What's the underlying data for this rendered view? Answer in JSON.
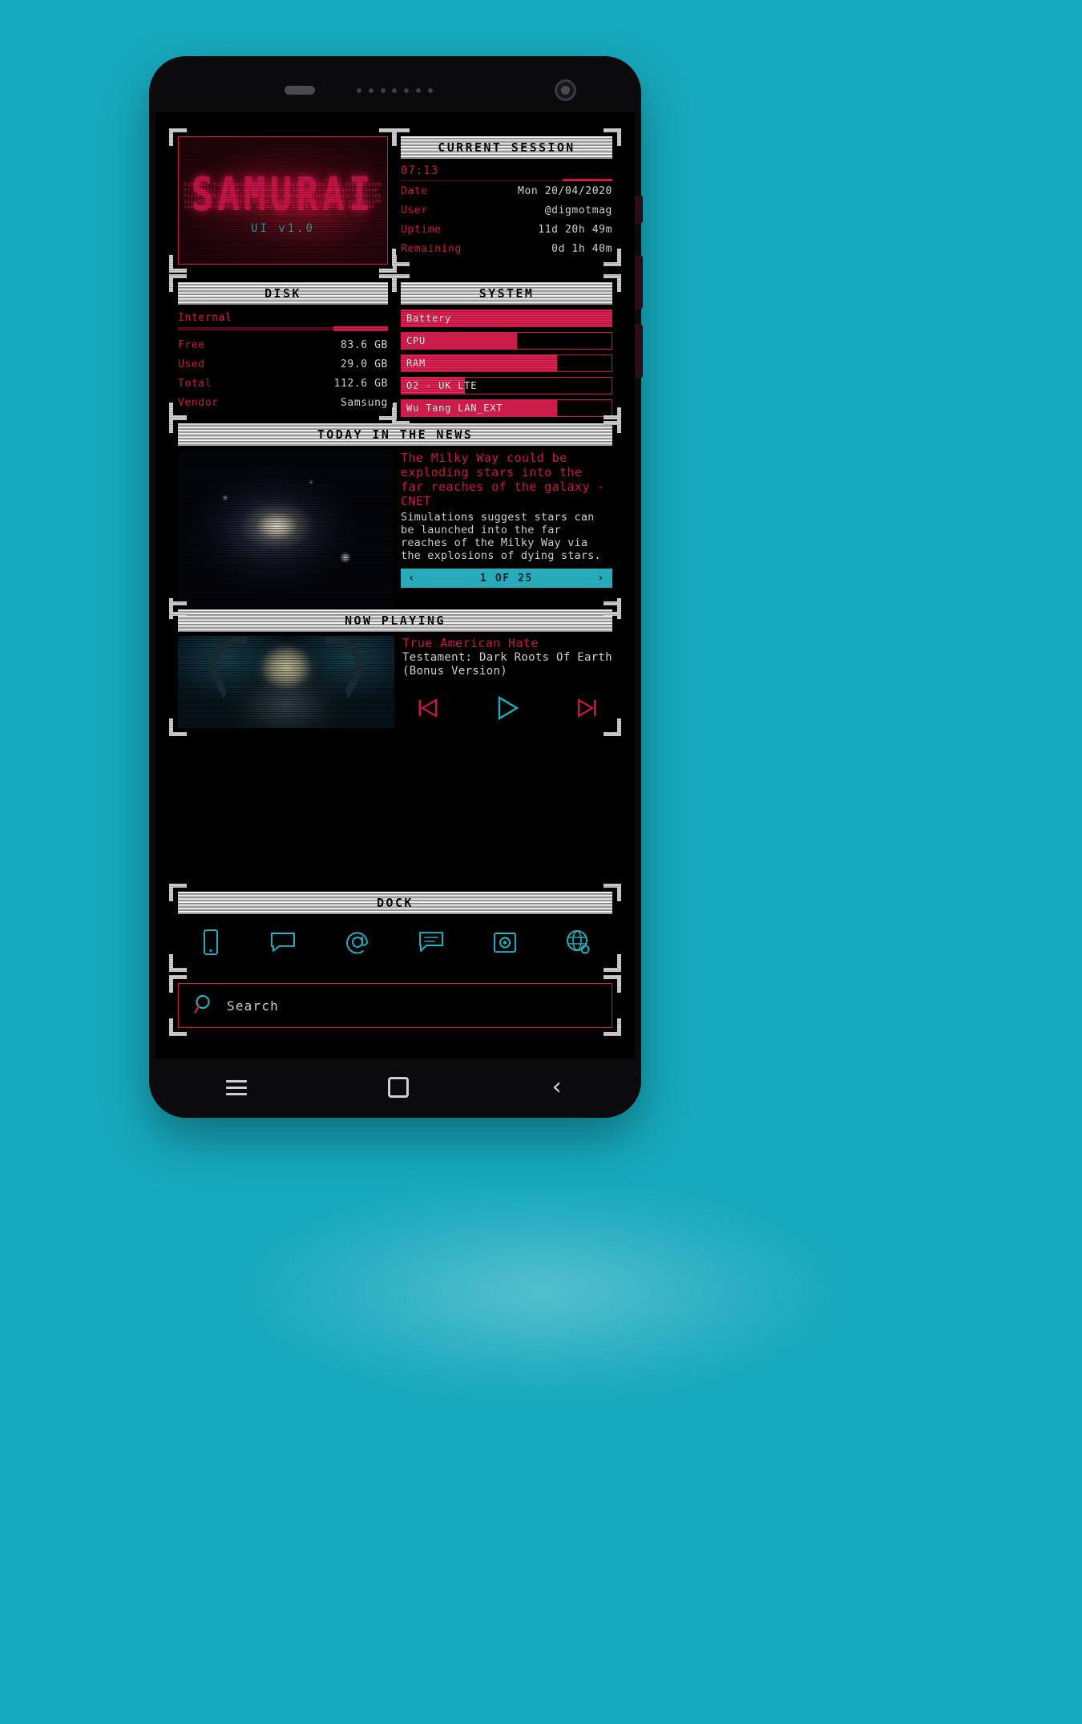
{
  "theme": {
    "accent_red": "#d6174a",
    "accent_teal": "#17a9bd",
    "background": "#17a9bd",
    "screen_bg": "#000000"
  },
  "logo": {
    "wordmark": "SAMURAI",
    "version": "UI v1.0",
    "binary": "01010011 01100 1010110 010101 1010010 01100 1001 0000001010001 0110111 101110 10100 10011101 1104100 0110010101010 0000 01101 1100110 111101110 10000 10000 00110000 10110170 101101111101101 1001 10011 10010 000001110 100011 01010 0110101100 1001100 0100101 01101 01100 0100 010 0 0101100111 00101100"
  },
  "session": {
    "title": "CURRENT SESSION",
    "clock": "07:13",
    "rows": [
      {
        "label": "Date",
        "value": "Mon 20/04/2020"
      },
      {
        "label": "User",
        "value": "@digmotmag"
      },
      {
        "label": "Uptime",
        "value": "11d 20h 49m"
      },
      {
        "label": "Remaining",
        "value": "0d 1h 40m"
      }
    ]
  },
  "disk": {
    "title": "DISK",
    "subtitle": "Internal",
    "meter_percent": 26,
    "rows": [
      {
        "label": "Free",
        "value": "83.6 GB"
      },
      {
        "label": "Used",
        "value": "29.0 GB"
      },
      {
        "label": "Total",
        "value": "112.6 GB"
      },
      {
        "label": "Vendor",
        "value": "Samsung"
      }
    ]
  },
  "system": {
    "title": "SYSTEM",
    "bars": [
      {
        "label": "Battery",
        "suffix": "",
        "percent": 100
      },
      {
        "label": "CPU",
        "suffix": "",
        "percent": 55
      },
      {
        "label": "RAM",
        "suffix": "",
        "percent": 74
      },
      {
        "label": "O2 - UK",
        "suffix": "LTE",
        "percent": 30
      },
      {
        "label": "Wu Tang LAN_EXT",
        "suffix": "",
        "percent": 74
      }
    ]
  },
  "news": {
    "title": "TODAY IN THE NEWS",
    "headline": "The Milky Way could be exploding stars into the far reaches of the galaxy - CNET",
    "description": "Simulations suggest stars can be launched into the far reaches of the Milky Way via the explosions of dying stars.",
    "pager_label": "1 OF 25",
    "prev_glyph": "‹",
    "next_glyph": "›"
  },
  "now_playing": {
    "title": "NOW PLAYING",
    "track": "True American Hate",
    "album": "Testament: Dark Roots Of Earth (Bonus Version)",
    "controls": {
      "previous": "previous-track",
      "play": "play",
      "next": "next-track"
    }
  },
  "dock": {
    "title": "DOCK",
    "items": [
      {
        "icon": "phone-icon",
        "label": "Phone"
      },
      {
        "icon": "message-icon",
        "label": "Messages"
      },
      {
        "icon": "at-email-icon",
        "label": "Email"
      },
      {
        "icon": "chat-icon",
        "label": "Chat"
      },
      {
        "icon": "camera-icon",
        "label": "Camera"
      },
      {
        "icon": "browser-globe-icon",
        "label": "Browser"
      }
    ]
  },
  "search": {
    "placeholder": "Search",
    "icon": "search-icon"
  },
  "navbar": {
    "menu": "menu-button",
    "home": "home-button",
    "back": "back-button"
  }
}
